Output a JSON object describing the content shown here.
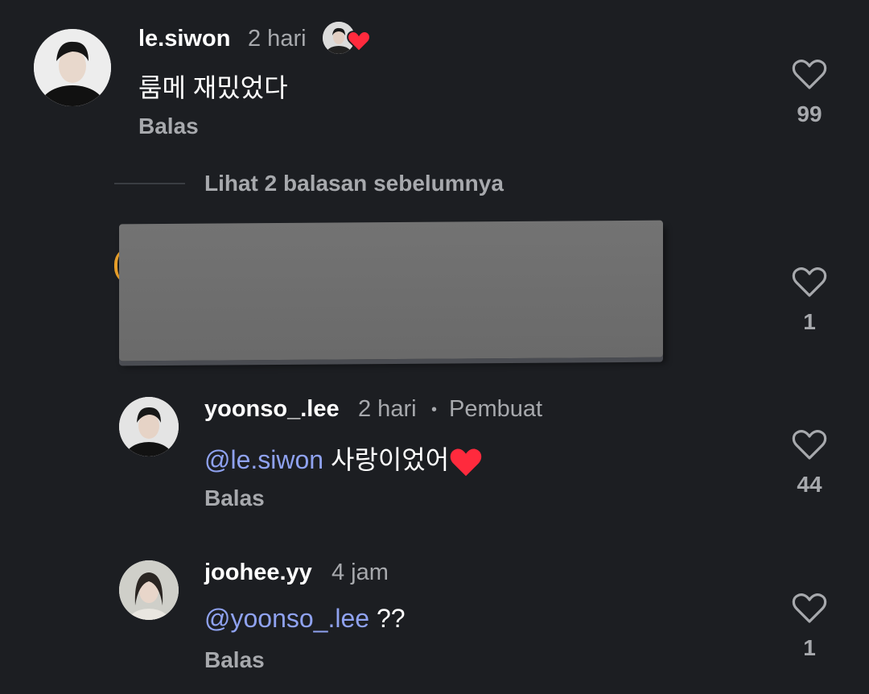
{
  "comment1": {
    "username": "le.siwon",
    "time": "2 hari",
    "text": "룸메 재밌었다",
    "reply_label": "Balas",
    "like_count": "99"
  },
  "view_replies": "Lihat 2 balasan sebelumnya",
  "hidden_reply": {
    "like_count": "1"
  },
  "comment2": {
    "username": "yoonso_.lee",
    "time": "2 hari",
    "separator": "•",
    "author_badge": "Pembuat",
    "mention": "@le.siwon",
    "text": " 사랑이었어",
    "reply_label": "Balas",
    "like_count": "44"
  },
  "comment3": {
    "username": "joohee.yy",
    "time": "4 jam",
    "mention": "@yoonso_.lee",
    "text": " ??",
    "reply_label": "Balas",
    "like_count": "1"
  },
  "colors": {
    "background": "#1c1e22",
    "mention": "#8fa2f0",
    "muted": "#a7a9ad",
    "heart": "#ff2a3d"
  }
}
